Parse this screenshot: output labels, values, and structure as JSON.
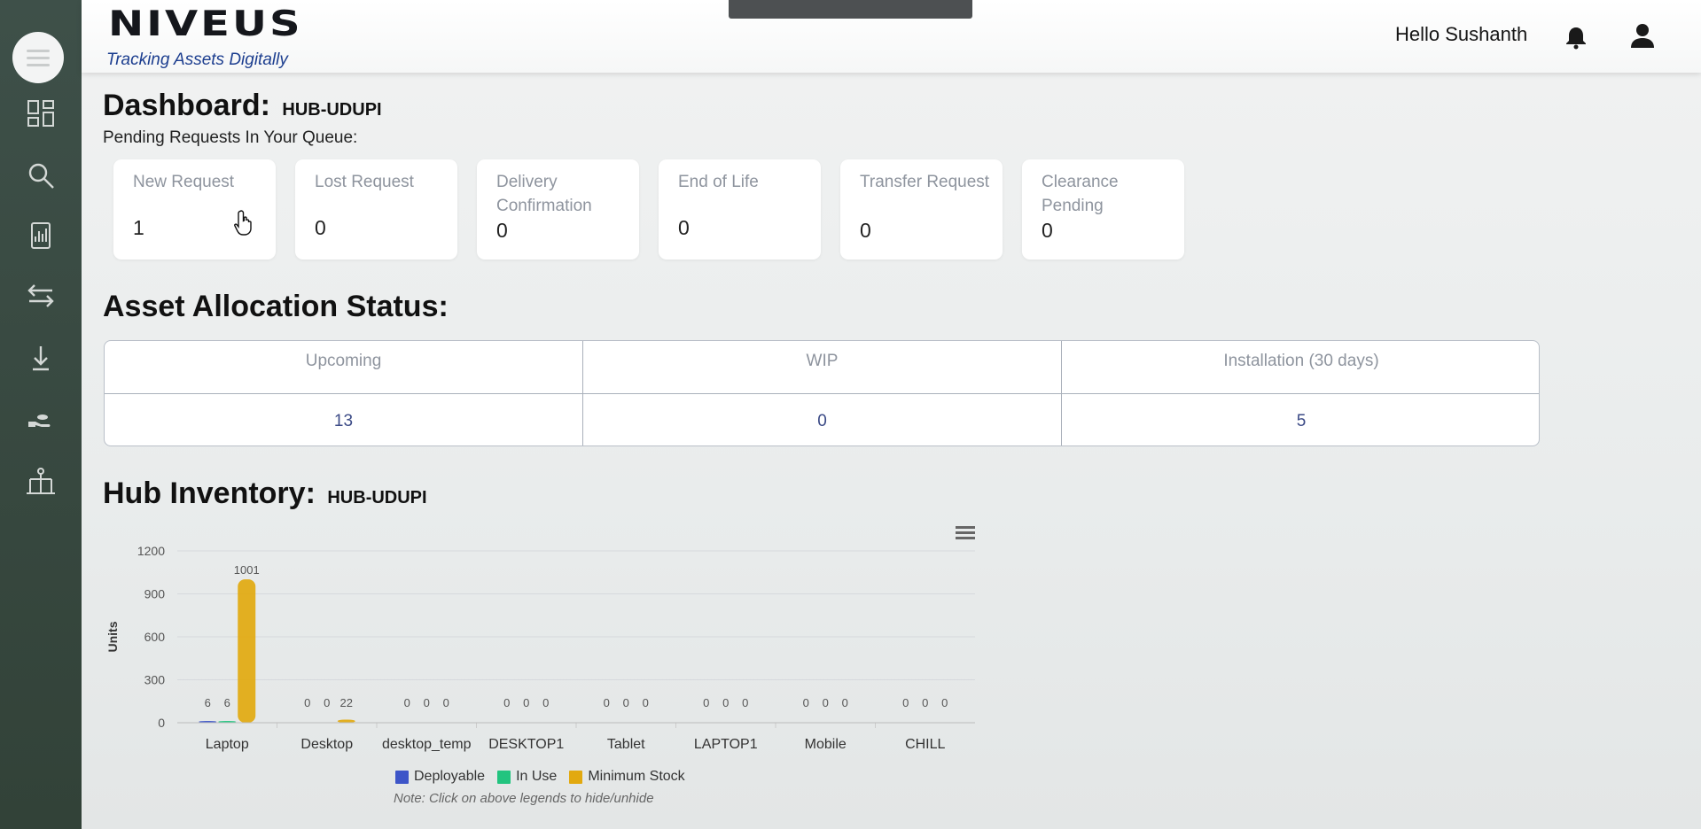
{
  "header": {
    "logo": "NIVEUS",
    "tagline": "Tracking Assets Digitally",
    "greeting": "Hello Sushanth"
  },
  "sidebar": {
    "icons": [
      "menu-icon",
      "dashboard-icon",
      "search-icon",
      "report-icon",
      "transfer-icon",
      "download-icon",
      "handover-icon",
      "hierarchy-icon"
    ]
  },
  "dashboard": {
    "title": "Dashboard:",
    "hub": "HUB-UDUPI",
    "pending_label": "Pending Requests In Your Queue:",
    "cards": [
      {
        "label": "New Request",
        "value": "1"
      },
      {
        "label": "Lost Request",
        "value": "0"
      },
      {
        "label": "Delivery Confirmation",
        "value": "0"
      },
      {
        "label": "End of Life",
        "value": "0"
      },
      {
        "label": "Transfer Request",
        "value": "0"
      },
      {
        "label": "Clearance Pending",
        "value": "0"
      }
    ]
  },
  "allocation": {
    "title": "Asset Allocation Status:",
    "columns": [
      {
        "label": "Upcoming",
        "value": "13"
      },
      {
        "label": "WIP",
        "value": "0"
      },
      {
        "label": "Installation (30 days)",
        "value": "5"
      }
    ]
  },
  "inventory": {
    "title": "Hub Inventory:",
    "hub": "HUB-UDUPI",
    "note": "Note: Click on above legends to hide/unhide"
  },
  "colors": {
    "deployable": "#3d55c8",
    "in_use": "#22c47f",
    "minimum_stock": "#e2a90f",
    "sidebar": "#3a4a42"
  },
  "chart_data": {
    "type": "bar",
    "categories": [
      "Laptop",
      "Desktop",
      "desktop_temp",
      "DESKTOP1",
      "Tablet",
      "LAPTOP1",
      "Mobile",
      "CHILL"
    ],
    "series": [
      {
        "name": "Deployable",
        "values": [
          6,
          0,
          0,
          0,
          0,
          0,
          0,
          0
        ]
      },
      {
        "name": "In Use",
        "values": [
          6,
          0,
          0,
          0,
          0,
          0,
          0,
          0
        ]
      },
      {
        "name": "Minimum Stock",
        "values": [
          1001,
          22,
          0,
          0,
          0,
          0,
          0,
          0
        ]
      }
    ],
    "ylabel": "Units",
    "yticks": [
      0,
      300,
      600,
      900,
      1200
    ],
    "ylim": [
      0,
      1200
    ],
    "grid": true,
    "legend": "bottom"
  }
}
